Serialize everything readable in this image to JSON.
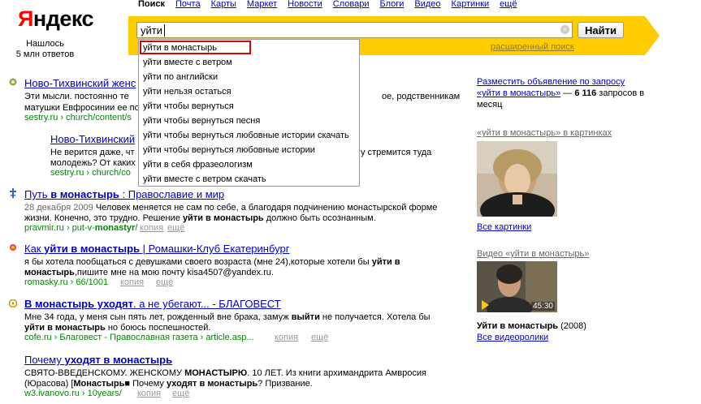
{
  "logo": {
    "first": "Я",
    "rest": "ндекс"
  },
  "found": {
    "line1": "Нашлось",
    "line2": "5 млн ответов"
  },
  "nav": {
    "current": "Поиск",
    "items": [
      "Почта",
      "Карты",
      "Маркет",
      "Новости",
      "Словари",
      "Блоги",
      "Видео",
      "Картинки",
      "ещё"
    ]
  },
  "search": {
    "query": "уйти",
    "button": "Найти",
    "advanced": "расширенный поиск"
  },
  "suggest": [
    "уйти в монастырь",
    "уйти вместе с ветром",
    "уйти по английски",
    "уйти нельзя остаться",
    "уйти чтобы вернуться",
    "уйти чтобы вернуться песня",
    "уйти чтобы вернуться любовные истории скачать",
    "уйти чтобы вернуться любовные истории",
    "уйти в себя фразеологизм",
    "уйти вместе с ветром скачать"
  ],
  "results": {
    "r1": {
      "title": "Ново-Тихвинский женс",
      "s1": "Эти мысли. постоянно те",
      "s1b": "ое, родственникам",
      "s2": "матушки Евфросинии ее по",
      "url": "sestry.ru › church/content/s"
    },
    "r2": {
      "title": "Ново-Тихвинский",
      "s1": "Не верится даже, чт",
      "s1b": "у стремится туда",
      "s2": "молодежь? От каких",
      "url": "sestry.ru › church/co"
    },
    "r3": {
      "title_a": "Путь ",
      "title_b": "в монастырь",
      "title_c": " : Православие и мир",
      "date": "28 декабря 2009",
      "s1": "Человек меняется не сам по себе, а благодаря подчинению монастырской форме",
      "s2a": "жизни. Конечно, это трудно. Решение ",
      "s2b": "уйти в монастырь",
      "s2c": " должно быть осознанным.",
      "url_a": "pravmir.ru › put-v-",
      "url_b": "monastyr",
      "url_c": "/",
      "copy": "копия",
      "more": "ещё"
    },
    "r4": {
      "title_a": "Как ",
      "title_b": "уйти в монастырь",
      "title_c": " | Ромашки-Клуб Екатеринбург",
      "s1a": "я бы хотела пообщаться с девушками своего возраста (мне 24),которые хотели бы ",
      "s1b": "уйти в",
      "s2a": "монастырь",
      "s2b": ",пишите мне на мою почту kisa4507@yandex.ru.",
      "url": "romasky.ru › 66/1001",
      "copy": "копия",
      "more": "ещё"
    },
    "r5": {
      "title_a": "В монастырь уходят",
      "title_b": ". а не убегают... - БЛАГОВЕСТ",
      "s1a": "Мне 34 года, у меня сын пять лет, рожденный вне брака, замуж ",
      "s1b": "выйти",
      "s1c": " не получается. Хотела бы",
      "s2a": "уйти в монастырь",
      "s2b": " но боюсь поспешностей.",
      "url": "cofe.ru › Благовест - Православная газета › article.asp...",
      "copy": "копия",
      "more": "ещё"
    },
    "r6": {
      "title_a": "Почему ",
      "title_b": "уходят в монастырь",
      "s1a": "СВЯТО-ВВЕДЕНСКОМУ. ЖЕНСКОМУ ",
      "s1b": "МОНАСТЫРЮ",
      "s1c": ". 10 ЛЕТ. Из книги архимандрита Амвросия",
      "s2a": "(Юрасова) ",
      "s2b": "Монастырь",
      "s2c": " Почему ",
      "s2d": "уходят в монастырь",
      "s2e": "? Призвание.",
      "url": "w3.ivanovo.ru › 10years/",
      "copy": "копия",
      "more": "ещё"
    }
  },
  "right": {
    "ad_line1": "Разместить объявление по запросу",
    "ad_query": "«уйти в монастырь»",
    "ad_dash": " — ",
    "ad_count": "6 116",
    "ad_rest": " запросов в",
    "ad_month": "месяц",
    "images_title": "«уйти в монастырь» в картинках",
    "all_images": "Все картинки",
    "video_title": "Видео «уйти в монастырь»",
    "video_duration": "45:30",
    "video_name": "Уйти в монастырь",
    "video_year": " (2008)",
    "all_videos": "Все видеоролики"
  },
  "colors": {
    "brand_red": "#ff0000",
    "bar_yellow": "#ffcc00",
    "link": "#0000cc",
    "url_green": "#008000",
    "highlight_border": "#dd0000"
  }
}
